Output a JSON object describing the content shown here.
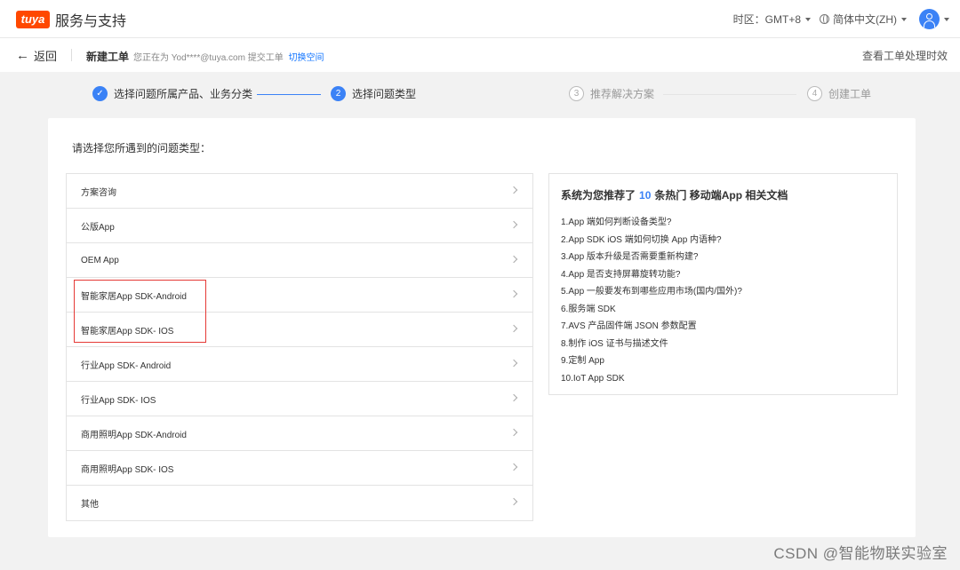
{
  "header": {
    "logo_text": "tuya",
    "title": "服务与支持",
    "timezone_label": "时区：",
    "timezone_value": "GMT+8",
    "language": "简体中文(ZH)"
  },
  "subheader": {
    "back_label": "返回",
    "page_title": "新建工单",
    "note_prefix": "您正在为 Yod****@tuya.com 提交工单",
    "switch_link": "切换空间",
    "right_link": "查看工单处理时效"
  },
  "steps": [
    {
      "num": "✓",
      "label": "选择问题所属产品、业务分类",
      "state": "done"
    },
    {
      "num": "2",
      "label": "选择问题类型",
      "state": "active"
    },
    {
      "num": "3",
      "label": "推荐解决方案",
      "state": "todo"
    },
    {
      "num": "4",
      "label": "创建工单",
      "state": "todo"
    }
  ],
  "main": {
    "prompt": "请选择您所遇到的问题类型：",
    "categories": [
      "方案咨询",
      "公版App",
      "OEM App",
      "智能家居App SDK-Android",
      "智能家居App SDK- IOS",
      "行业App SDK- Android",
      "行业App SDK- IOS",
      "商用照明App SDK-Android",
      "商用照明App SDK- IOS",
      "其他"
    ]
  },
  "recommend": {
    "title_prefix": "系统为您推荐了",
    "count": "10",
    "title_suffix": "条热门 移动端App 相关文档",
    "docs": [
      "1.App 端如何判断设备类型?",
      "2.App SDK iOS 端如何切换 App 内语种?",
      "3.App 版本升级是否需要重新构建?",
      "4.App 是否支持屏幕旋转功能?",
      "5.App 一般要发布到哪些应用市场(国内/国外)?",
      "6.服务端 SDK",
      "7.AVS 产品固件端 JSON 参数配置",
      "8.制作 iOS 证书与描述文件",
      "9.定制 App",
      "10.IoT App SDK"
    ]
  },
  "watermark": "CSDN @智能物联实验室",
  "colors": {
    "brand": "#ff4800",
    "accent": "#3b82f6",
    "highlight_border": "#e53935"
  }
}
